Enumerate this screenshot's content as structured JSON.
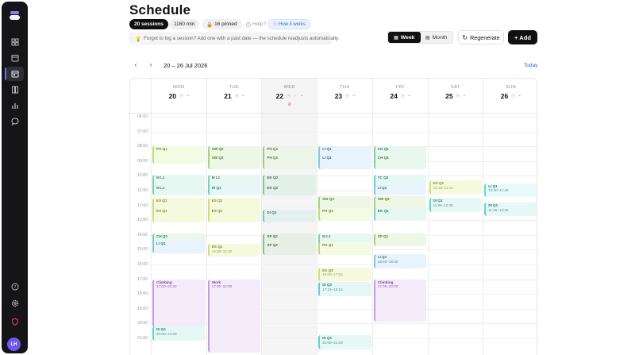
{
  "colors": {
    "sidebar": "#151517",
    "accent": "#2b62d9",
    "today": "#e0556b"
  },
  "sidebar": {
    "icons": [
      "dashboard-icon",
      "calendar-icon",
      "schedule-icon",
      "book-icon",
      "chart-icon",
      "chat-icon"
    ],
    "bottom_icons": [
      "help-icon",
      "settings-icon",
      "shield-icon"
    ],
    "avatar": "LH"
  },
  "header": {
    "title": "Schedule",
    "sessions": "20 sessions",
    "minutes": "1160 min",
    "pinned": "16 pinned",
    "help": "Help?",
    "how": "How it works",
    "notice": "Forgot to log a session? Add one with a past date — the schedule readjusts automatically."
  },
  "toolbar": {
    "week": "Week",
    "month": "Month",
    "regenerate": "Regenerate",
    "add": "+ Add"
  },
  "nav": {
    "prev": "‹",
    "next": "›",
    "range": "20 – 26 Jul 2026",
    "today": "Today"
  },
  "days": [
    {
      "dow": "MON",
      "num": "20"
    },
    {
      "dow": "TUE",
      "num": "21"
    },
    {
      "dow": "WED",
      "num": "22",
      "today": true
    },
    {
      "dow": "THU",
      "num": "23"
    },
    {
      "dow": "FRI",
      "num": "24"
    },
    {
      "dow": "SAT",
      "num": "25"
    },
    {
      "dow": "SUN",
      "num": "26"
    }
  ],
  "hours": [
    "06:00",
    "07:00",
    "08:00",
    "09:00",
    "10:00",
    "11:00",
    "12:00",
    "13:00",
    "14:00",
    "15:00",
    "16:00",
    "17:00",
    "18:00",
    "19:00",
    "20:00",
    "21:00"
  ],
  "events": [
    {
      "day": 0,
      "start": 8.0,
      "end": 9.2,
      "title": "PH Q1",
      "sub": "",
      "bg": "#f3fbe3",
      "bd": "#b8de7a",
      "fg": "#6a8a2c"
    },
    {
      "day": 0,
      "start": 9.9,
      "end": 11.0,
      "title": "M L1",
      "sub": "",
      "bg": "#e7f8f2",
      "bd": "#7fd2b3",
      "fg": "#2f7f63"
    },
    {
      "day": 0,
      "start": 10.6,
      "end": 11.4,
      "title": "M L1",
      "sub": "",
      "bg": "#e7f8f2",
      "bd": "#7fd2b3",
      "fg": "#2f7f63"
    },
    {
      "day": 0,
      "start": 11.5,
      "end": 12.6,
      "title": "ES Q1",
      "sub": "",
      "bg": "#f5fadf",
      "bd": "#c9e07c",
      "fg": "#7a8a2c"
    },
    {
      "day": 0,
      "start": 12.2,
      "end": 13.2,
      "title": "ES Q1",
      "sub": "",
      "bg": "#f5fadf",
      "bd": "#c9e07c",
      "fg": "#7a8a2c"
    },
    {
      "day": 0,
      "start": 13.9,
      "end": 14.9,
      "title": "CH Q1",
      "sub": "",
      "bg": "#e9f7ef",
      "bd": "#7fd29b",
      "fg": "#2f7f4a"
    },
    {
      "day": 0,
      "start": 14.4,
      "end": 15.3,
      "title": "LI Q1",
      "sub": "",
      "bg": "#e8f3fb",
      "bd": "#8ac3ea",
      "fg": "#2f6a8f"
    },
    {
      "day": 0,
      "start": 17.0,
      "end": 20.3,
      "title": "Climbing",
      "sub": "17:00–20:30",
      "bg": "#f4ebfb",
      "bd": "#c79ae8",
      "fg": "#7a43a5"
    },
    {
      "day": 0,
      "start": 20.2,
      "end": 21.2,
      "title": "DI Q1",
      "sub": "20:00–21:00",
      "bg": "#e6f8f6",
      "bd": "#6ccfc3",
      "fg": "#2a7a70"
    },
    {
      "day": 1,
      "start": 8.0,
      "end": 9.2,
      "title": "SW Q2",
      "sub": "",
      "bg": "#eef7e5",
      "bd": "#a3d57e",
      "fg": "#4d7f2a"
    },
    {
      "day": 1,
      "start": 8.6,
      "end": 9.6,
      "title": "SW Q2",
      "sub": "",
      "bg": "#eef7e5",
      "bd": "#a3d57e",
      "fg": "#4d7f2a"
    },
    {
      "day": 1,
      "start": 9.9,
      "end": 11.0,
      "title": "M L1",
      "sub": "",
      "bg": "#e7f8f2",
      "bd": "#7fd2b3",
      "fg": "#2f7f63"
    },
    {
      "day": 1,
      "start": 10.6,
      "end": 11.4,
      "title": "DI Q1",
      "sub": "",
      "bg": "#e6f8f6",
      "bd": "#6ccfc3",
      "fg": "#2a7a70"
    },
    {
      "day": 1,
      "start": 11.5,
      "end": 12.6,
      "title": "ES Q1",
      "sub": "",
      "bg": "#f5fadf",
      "bd": "#c9e07c",
      "fg": "#7a8a2c"
    },
    {
      "day": 1,
      "start": 12.2,
      "end": 13.2,
      "title": "ES Q1",
      "sub": "",
      "bg": "#f5fadf",
      "bd": "#c9e07c",
      "fg": "#7a8a2c"
    },
    {
      "day": 1,
      "start": 14.6,
      "end": 15.5,
      "title": "ES Q1",
      "sub": "14:30–15:30",
      "bg": "#f5fadf",
      "bd": "#c9e07c",
      "fg": "#7a8a2c"
    },
    {
      "day": 1,
      "start": 17.0,
      "end": 22.0,
      "title": "Work",
      "sub": "17:00–22:00",
      "bg": "#f4ebfb",
      "bd": "#c79ae8",
      "fg": "#7a43a5"
    },
    {
      "day": 2,
      "start": 8.0,
      "end": 9.2,
      "title": "PH Q1",
      "sub": "",
      "bg": "#edf4e8",
      "bd": "#a9c98a",
      "fg": "#5a7a3c"
    },
    {
      "day": 2,
      "start": 8.6,
      "end": 9.6,
      "title": "PH Q1",
      "sub": "",
      "bg": "#edf4e8",
      "bd": "#a9c98a",
      "fg": "#5a7a3c"
    },
    {
      "day": 2,
      "start": 9.9,
      "end": 10.9,
      "title": "EK Q2",
      "sub": "",
      "bg": "#e4f0ea",
      "bd": "#8ac0a4",
      "fg": "#3c6a52"
    },
    {
      "day": 2,
      "start": 10.6,
      "end": 11.4,
      "title": "EK Q2",
      "sub": "",
      "bg": "#e4f0ea",
      "bd": "#8ac0a4",
      "fg": "#3c6a52"
    },
    {
      "day": 2,
      "start": 12.3,
      "end": 13.2,
      "title": "DI Q1",
      "sub": "",
      "bg": "#e3f0ee",
      "bd": "#80c2b8",
      "fg": "#3a6e66"
    },
    {
      "day": 2,
      "start": 13.9,
      "end": 14.8,
      "title": "SP Q2",
      "sub": "",
      "bg": "#e8f0e6",
      "bd": "#94bd8a",
      "fg": "#466d3c"
    },
    {
      "day": 2,
      "start": 14.5,
      "end": 15.4,
      "title": "SP Q2",
      "sub": "",
      "bg": "#e8f0e6",
      "bd": "#94bd8a",
      "fg": "#466d3c"
    },
    {
      "day": 3,
      "start": 8.0,
      "end": 9.0,
      "title": "LI Q1",
      "sub": "",
      "bg": "#e8f3fb",
      "bd": "#8ac3ea",
      "fg": "#2f6a8f"
    },
    {
      "day": 3,
      "start": 8.6,
      "end": 9.6,
      "title": "LI Q1",
      "sub": "",
      "bg": "#e8f3fb",
      "bd": "#8ac3ea",
      "fg": "#2f6a8f"
    },
    {
      "day": 3,
      "start": 11.4,
      "end": 12.4,
      "title": "SW Q3",
      "sub": "",
      "bg": "#eef7e5",
      "bd": "#a3d57e",
      "fg": "#4d7f2a"
    },
    {
      "day": 3,
      "start": 12.2,
      "end": 13.1,
      "title": "PH Q1",
      "sub": "",
      "bg": "#f3fbe3",
      "bd": "#b8de7a",
      "fg": "#6a8a2c"
    },
    {
      "day": 3,
      "start": 13.9,
      "end": 14.8,
      "title": "M L1",
      "sub": "",
      "bg": "#e7f8f2",
      "bd": "#7fd2b3",
      "fg": "#2f7f63"
    },
    {
      "day": 3,
      "start": 14.5,
      "end": 15.4,
      "title": "PH Q1",
      "sub": "",
      "bg": "#f3fbe3",
      "bd": "#b8de7a",
      "fg": "#6a8a2c"
    },
    {
      "day": 3,
      "start": 16.2,
      "end": 17.2,
      "title": "ES Q3",
      "sub": "16:00–17:00",
      "bg": "#f5fadf",
      "bd": "#c9e07c",
      "fg": "#7a8a2c"
    },
    {
      "day": 3,
      "start": 17.2,
      "end": 18.2,
      "title": "DI Q2",
      "sub": "17:15–18:15",
      "bg": "#e6f8f6",
      "bd": "#6ccfc3",
      "fg": "#2a7a70"
    },
    {
      "day": 3,
      "start": 20.8,
      "end": 21.8,
      "title": "DI Q1",
      "sub": "20:00–21:00",
      "bg": "#e6f8f6",
      "bd": "#6ccfc3",
      "fg": "#2a7a70"
    },
    {
      "day": 4,
      "start": 8.0,
      "end": 9.2,
      "title": "CH Q1",
      "sub": "",
      "bg": "#e9f7ef",
      "bd": "#7fd29b",
      "fg": "#2f7f4a"
    },
    {
      "day": 4,
      "start": 8.6,
      "end": 9.6,
      "title": "CH Q1",
      "sub": "",
      "bg": "#e9f7ef",
      "bd": "#7fd29b",
      "fg": "#2f7f4a"
    },
    {
      "day": 4,
      "start": 9.9,
      "end": 10.9,
      "title": "TC Q2",
      "sub": "",
      "bg": "#e6f8f6",
      "bd": "#6ccfc3",
      "fg": "#2a7a70"
    },
    {
      "day": 4,
      "start": 10.6,
      "end": 11.4,
      "title": "LI Q1",
      "sub": "",
      "bg": "#e8f3fb",
      "bd": "#8ac3ea",
      "fg": "#2f6a8f"
    },
    {
      "day": 4,
      "start": 11.4,
      "end": 12.4,
      "title": "SW Q3",
      "sub": "",
      "bg": "#eef7e5",
      "bd": "#a3d57e",
      "fg": "#4d7f2a"
    },
    {
      "day": 4,
      "start": 12.2,
      "end": 13.1,
      "title": "EK Q2",
      "sub": "",
      "bg": "#e7f8f2",
      "bd": "#7fd2b3",
      "fg": "#2f7f63"
    },
    {
      "day": 4,
      "start": 13.9,
      "end": 14.8,
      "title": "SP Q1",
      "sub": "",
      "bg": "#eef7e5",
      "bd": "#a3d57e",
      "fg": "#4d7f2a"
    },
    {
      "day": 4,
      "start": 15.3,
      "end": 16.3,
      "title": "LI Q1",
      "sub": "15:00–16:00",
      "bg": "#e8f3fb",
      "bd": "#8ac3ea",
      "fg": "#2f6a8f"
    },
    {
      "day": 4,
      "start": 17.0,
      "end": 19.9,
      "title": "Climbing",
      "sub": "17:00–20:00",
      "bg": "#f4ebfb",
      "bd": "#c79ae8",
      "fg": "#7a43a5"
    },
    {
      "day": 5,
      "start": 10.3,
      "end": 11.3,
      "title": "ES Q1",
      "sub": "10:15–11:15",
      "bg": "#f5fadf",
      "bd": "#c9e07c",
      "fg": "#7a8a2c"
    },
    {
      "day": 5,
      "start": 11.5,
      "end": 12.5,
      "title": "DI Q1",
      "sub": "11:30–12:30",
      "bg": "#e6f8f6",
      "bd": "#6ccfc3",
      "fg": "#2a7a70"
    },
    {
      "day": 6,
      "start": 10.5,
      "end": 11.5,
      "title": "LI Q1",
      "sub": "10:30–11:30",
      "bg": "#e6fbfa",
      "bd": "#6ad6d0",
      "fg": "#2a7a78"
    },
    {
      "day": 6,
      "start": 11.8,
      "end": 12.8,
      "title": "DI Q1",
      "sub": "11:45–12:45",
      "bg": "#e6f8f6",
      "bd": "#6ccfc3",
      "fg": "#2a7a70"
    }
  ]
}
